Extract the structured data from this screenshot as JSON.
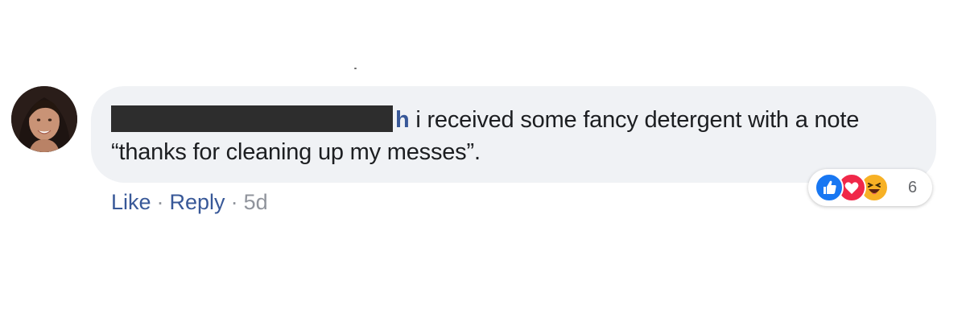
{
  "comment": {
    "author_visible_fragment": "h",
    "text": "i received some fancy detergent with a note “thanks for cleaning up my messes”."
  },
  "actions": {
    "like_label": "Like",
    "separator": "·",
    "reply_label": "Reply",
    "timestamp": "5d"
  },
  "reactions": {
    "icons": [
      "like-icon",
      "love-icon",
      "haha-icon"
    ],
    "count": "6"
  },
  "colors": {
    "link": "#385898",
    "bubble": "#f0f2f5",
    "muted": "#90949c",
    "like": "#1877f2",
    "love": "#f02849",
    "haha": "#f7b125"
  }
}
